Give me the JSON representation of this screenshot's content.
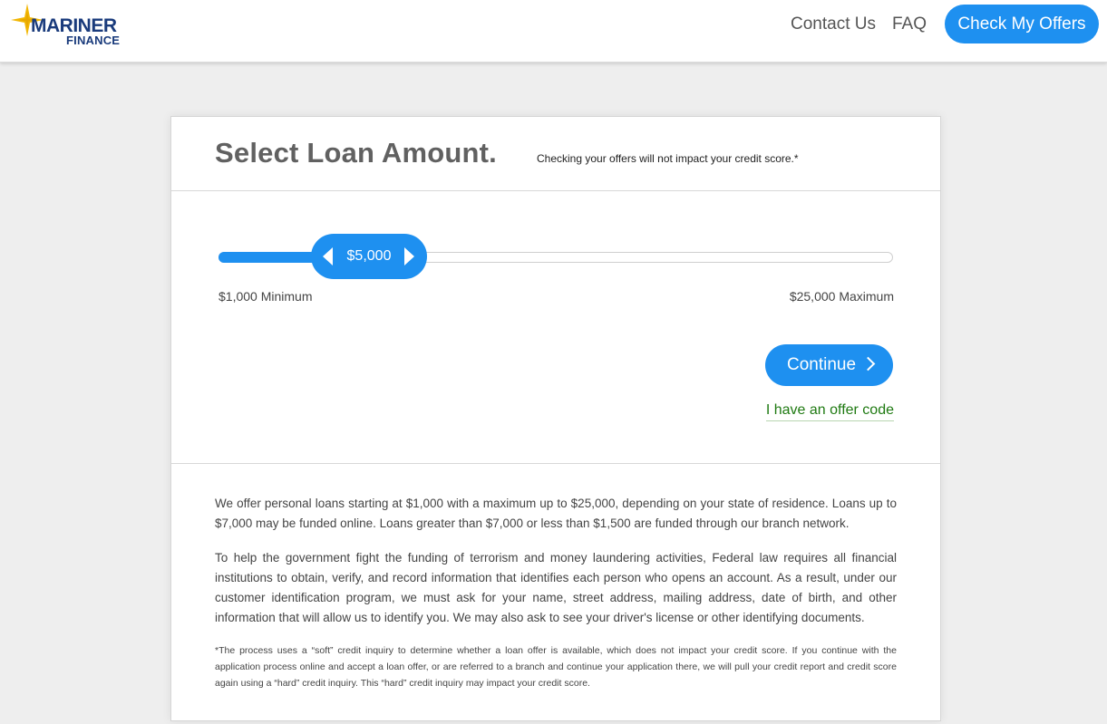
{
  "header": {
    "logo": {
      "line1": "MARINER",
      "line2": "FINANCE"
    },
    "nav": {
      "contact": "Contact Us",
      "faq": "FAQ"
    },
    "cta": "Check My Offers"
  },
  "card": {
    "title": "Select Loan Amount.",
    "subtitle": "Checking your offers will not impact your credit score.*",
    "slider": {
      "value_label": "$5,000",
      "value": 5000,
      "min": 1000,
      "max": 25000,
      "min_label": "$1,000 Minimum",
      "max_label": "$25,000 Maximum"
    },
    "continue_label": "Continue",
    "offer_code_label": "I have an offer code",
    "paragraphs": [
      "We offer personal loans starting at $1,000 with a maximum up to $25,000, depending on your state of residence. Loans up to $7,000 may be funded online. Loans greater than $7,000 or less than $1,500 are funded through our branch network.",
      "To help the government fight the funding of terrorism and money laundering activities, Federal law requires all financial institutions to obtain, verify, and record information that identifies each person who opens an account. As a result, under our customer identification program, we must ask for your name, street address, mailing address, date of birth, and other information that will allow us to identify you. We may also ask to see your driver's license or other identifying documents.",
      "*The process uses a “soft” credit inquiry to determine whether a loan offer is available, which does not impact your credit score. If you continue with the application process online and accept a loan offer, or are referred to a branch and continue your application there, we will pull your credit report and credit score again using a “hard” credit inquiry. This “hard” credit inquiry may impact your credit score."
    ]
  },
  "colors": {
    "accent": "#1e90f0",
    "brand_navy": "#1a3b7c",
    "brand_gold": "#f2b705",
    "link_green": "#1f7a12"
  },
  "icons": {
    "logo_mark": "compass-star-icon",
    "slider_left": "triangle-left-icon",
    "slider_right": "triangle-right-icon",
    "continue": "chevron-right-icon"
  }
}
